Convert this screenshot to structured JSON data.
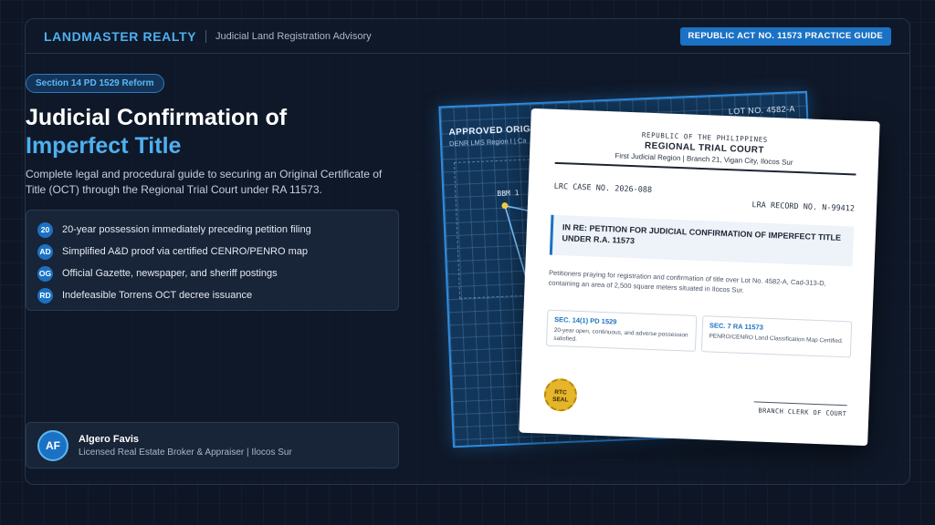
{
  "header": {
    "brand": "LANDMASTER REALTY",
    "subtitle": "Judicial Land Registration Advisory",
    "badge": "REPUBLIC ACT NO. 11573 PRACTICE GUIDE"
  },
  "hero": {
    "tag": "Section 14 PD 1529 Reform",
    "title_line1": "Judicial Confirmation of",
    "title_line2": "Imperfect Title",
    "description": "Complete legal and procedural guide to securing an Original Certificate of Title (OCT) through the Regional Trial Court under RA 11573."
  },
  "features": [
    {
      "badge": "20",
      "text": "20-year possession immediately preceding petition filing"
    },
    {
      "badge": "AD",
      "text": "Simplified A&D proof via certified CENRO/PENRO map"
    },
    {
      "badge": "OG",
      "text": "Official Gazette, newspaper, and sheriff postings"
    },
    {
      "badge": "RD",
      "text": "Indefeasible Torrens OCT decree issuance"
    }
  ],
  "author": {
    "initials": "AF",
    "name": "Algero Favis",
    "role": "Licensed Real Estate Broker & Appraiser | Ilocos Sur"
  },
  "map": {
    "title": "APPROVED ORIGI",
    "subtitle": "DENR LMS Region I | Ca",
    "lot": "LOT NO. 4582-A",
    "bbm_label": "BBM 1"
  },
  "document": {
    "republic": "REPUBLIC OF THE PHILIPPINES",
    "court": "REGIONAL TRIAL COURT",
    "region": "First Judicial Region | Branch 21, Vigan City, Ilocos Sur",
    "case_no": "LRC CASE NO. 2026-088",
    "lra_record": "LRA RECORD NO. N-99412",
    "callout": "IN RE: PETITION FOR JUDICIAL CONFIRMATION OF IMPERFECT TITLE UNDER R.A. 11573",
    "body": "Petitioners praying for registration and confirmation of title over Lot No. 4582-A, Cad-313-D, containing an area of 2,500 square meters situated in Ilocos Sur.",
    "box1_head": "SEC. 14(1) PD 1529",
    "box1_text": "20-year open, continuous, and adverse possession satisfied.",
    "box2_head": "SEC. 7 RA 11573",
    "box2_text": "PENRO/CENRO Land Classification Map Certified.",
    "seal": "RTC SEAL",
    "clerk": "BRANCH CLERK OF COURT"
  },
  "colors": {
    "accent": "#4fb0f0",
    "badge_blue": "#1b72c4",
    "background": "#0e1626",
    "seal_gold": "#e5b52a"
  }
}
